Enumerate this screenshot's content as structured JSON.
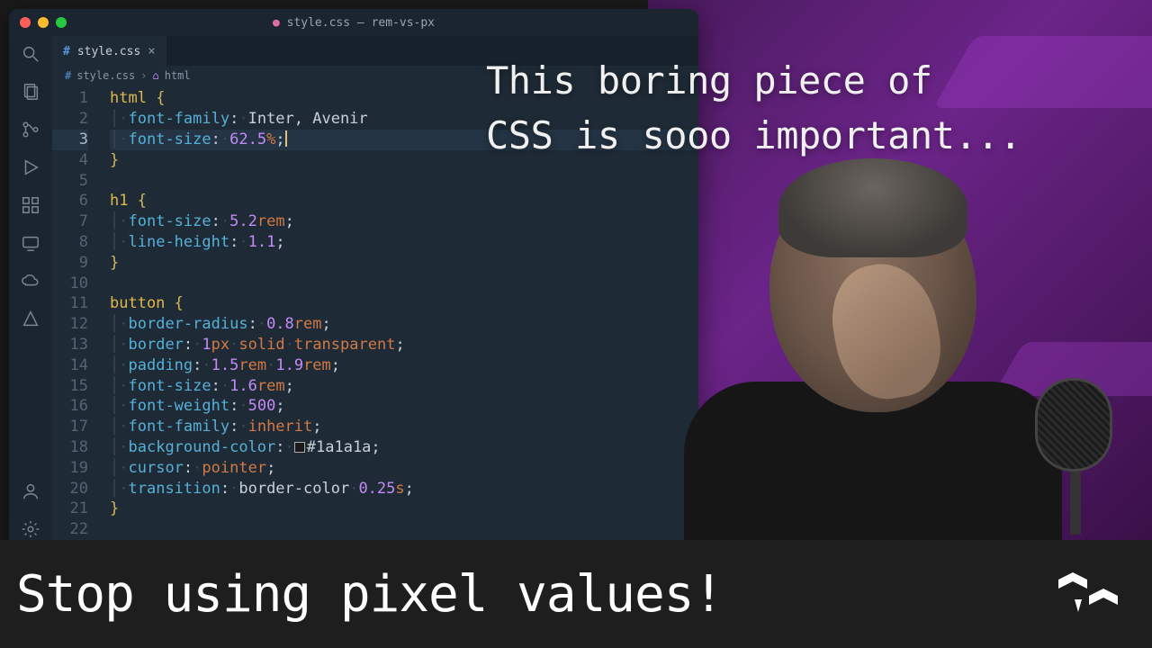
{
  "window": {
    "title_file": "style.css",
    "title_project": "rem-vs-px"
  },
  "tab": {
    "name": "style.css",
    "close": "×"
  },
  "breadcrumb": {
    "file": "style.css",
    "symbol": "html"
  },
  "code": {
    "lines": [
      {
        "n": 1,
        "t": "sel-open",
        "sel": "html"
      },
      {
        "n": 2,
        "t": "prop",
        "p": "font-family",
        "v": "Inter, Avenir",
        "semi": false
      },
      {
        "n": 3,
        "t": "prop-num",
        "p": "font-size",
        "num": "62.5",
        "unit": "%",
        "hl": true,
        "cursor": true
      },
      {
        "n": 4,
        "t": "close"
      },
      {
        "n": 5,
        "t": "blank"
      },
      {
        "n": 6,
        "t": "sel-open",
        "sel": "h1"
      },
      {
        "n": 7,
        "t": "prop-num",
        "p": "font-size",
        "num": "5.2",
        "unit": "rem"
      },
      {
        "n": 8,
        "t": "prop-num",
        "p": "line-height",
        "num": "1.1",
        "unit": ""
      },
      {
        "n": 9,
        "t": "close"
      },
      {
        "n": 10,
        "t": "blank"
      },
      {
        "n": 11,
        "t": "sel-open",
        "sel": "button"
      },
      {
        "n": 12,
        "t": "prop-num",
        "p": "border-radius",
        "num": "0.8",
        "unit": "rem"
      },
      {
        "n": 13,
        "t": "border",
        "p": "border",
        "num": "1",
        "unit": "px",
        "style": "solid",
        "color": "transparent"
      },
      {
        "n": 14,
        "t": "padding",
        "p": "padding",
        "n1": "1.5",
        "u1": "rem",
        "n2": "1.9",
        "u2": "rem"
      },
      {
        "n": 15,
        "t": "prop-num",
        "p": "font-size",
        "num": "1.6",
        "unit": "rem"
      },
      {
        "n": 16,
        "t": "prop-num",
        "p": "font-weight",
        "num": "500",
        "unit": ""
      },
      {
        "n": 17,
        "t": "prop-kw",
        "p": "font-family",
        "kw": "inherit"
      },
      {
        "n": 18,
        "t": "hex",
        "p": "background-color",
        "hex": "#1a1a1a"
      },
      {
        "n": 19,
        "t": "prop-kw",
        "p": "cursor",
        "kw": "pointer"
      },
      {
        "n": 20,
        "t": "transition",
        "p": "transition",
        "tprop": "border-color",
        "num": "0.25",
        "unit": "s"
      },
      {
        "n": 21,
        "t": "close"
      },
      {
        "n": 22,
        "t": "blank"
      }
    ]
  },
  "overlay": {
    "line1": "This boring piece of",
    "line2": "CSS is sooo important..."
  },
  "banner": {
    "text": "Stop using pixel values!"
  },
  "activity_icons": [
    "search-icon",
    "files-icon",
    "git-icon",
    "debug-icon",
    "extensions-icon",
    "remote-icon",
    "cloud-icon",
    "ai-icon"
  ],
  "activity_bottom": [
    "account-icon",
    "settings-icon"
  ]
}
